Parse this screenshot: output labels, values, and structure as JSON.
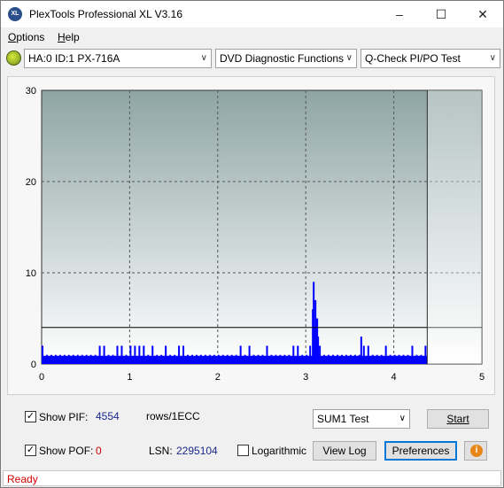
{
  "window": {
    "title": "PlexTools Professional XL V3.16",
    "app_icon_label": "XL",
    "controls": [
      "minimize-icon",
      "maximize-icon",
      "close-icon"
    ]
  },
  "menu": {
    "items": [
      {
        "label": "Options",
        "underline": "O"
      },
      {
        "label": "Help",
        "underline": "H"
      }
    ]
  },
  "toolbar": {
    "drive": "HA:0 ID:1  PX-716A",
    "function": "DVD Diagnostic Functions",
    "test": "Q-Check PI/PO Test"
  },
  "chart_data": {
    "type": "bar",
    "xlim": [
      0,
      5
    ],
    "ylim": [
      0,
      30
    ],
    "x_ticks": [
      "0",
      "1",
      "2",
      "3",
      "4",
      "5"
    ],
    "y_ticks": [
      "0",
      "10",
      "20",
      "30"
    ],
    "grid": true,
    "threshold_line": 4,
    "end_marker_x": 4.38,
    "series_color": "#0000ff",
    "series": [
      {
        "values": [
          [
            0.0,
            2
          ],
          [
            0.05,
            1
          ],
          [
            0.1,
            1
          ],
          [
            0.15,
            1
          ],
          [
            0.2,
            1
          ],
          [
            0.25,
            1
          ],
          [
            0.3,
            1
          ],
          [
            0.35,
            1
          ],
          [
            0.4,
            1
          ],
          [
            0.45,
            1
          ],
          [
            0.5,
            1
          ],
          [
            0.55,
            1
          ],
          [
            0.6,
            1
          ],
          [
            0.65,
            2
          ],
          [
            0.7,
            2
          ],
          [
            0.75,
            1
          ],
          [
            0.8,
            1
          ],
          [
            0.85,
            2
          ],
          [
            0.9,
            2
          ],
          [
            0.95,
            1
          ],
          [
            1.0,
            2
          ],
          [
            1.05,
            2
          ],
          [
            1.1,
            2
          ],
          [
            1.15,
            2
          ],
          [
            1.2,
            1
          ],
          [
            1.25,
            2
          ],
          [
            1.3,
            1
          ],
          [
            1.35,
            1
          ],
          [
            1.4,
            2
          ],
          [
            1.45,
            1
          ],
          [
            1.5,
            1
          ],
          [
            1.55,
            2
          ],
          [
            1.6,
            2
          ],
          [
            1.65,
            1
          ],
          [
            1.7,
            1
          ],
          [
            1.75,
            1
          ],
          [
            1.8,
            1
          ],
          [
            1.85,
            1
          ],
          [
            1.9,
            1
          ],
          [
            1.95,
            1
          ],
          [
            2.0,
            1
          ],
          [
            2.05,
            1
          ],
          [
            2.1,
            1
          ],
          [
            2.15,
            1
          ],
          [
            2.2,
            1
          ],
          [
            2.25,
            2
          ],
          [
            2.3,
            1
          ],
          [
            2.35,
            2
          ],
          [
            2.4,
            1
          ],
          [
            2.45,
            1
          ],
          [
            2.5,
            1
          ],
          [
            2.55,
            2
          ],
          [
            2.6,
            1
          ],
          [
            2.65,
            1
          ],
          [
            2.7,
            1
          ],
          [
            2.75,
            1
          ],
          [
            2.8,
            1
          ],
          [
            2.85,
            2
          ],
          [
            2.9,
            2
          ],
          [
            2.95,
            1
          ],
          [
            3.0,
            1
          ],
          [
            3.04,
            2
          ],
          [
            3.07,
            6
          ],
          [
            3.08,
            9
          ],
          [
            3.09,
            4
          ],
          [
            3.1,
            7
          ],
          [
            3.11,
            5
          ],
          [
            3.12,
            5
          ],
          [
            3.13,
            3
          ],
          [
            3.15,
            2
          ],
          [
            3.2,
            1
          ],
          [
            3.25,
            1
          ],
          [
            3.3,
            1
          ],
          [
            3.35,
            1
          ],
          [
            3.4,
            1
          ],
          [
            3.45,
            1
          ],
          [
            3.5,
            1
          ],
          [
            3.55,
            1
          ],
          [
            3.6,
            1
          ],
          [
            3.62,
            3
          ],
          [
            3.65,
            2
          ],
          [
            3.7,
            2
          ],
          [
            3.75,
            1
          ],
          [
            3.8,
            1
          ],
          [
            3.85,
            1
          ],
          [
            3.9,
            2
          ],
          [
            3.95,
            1
          ],
          [
            4.0,
            1
          ],
          [
            4.05,
            1
          ],
          [
            4.1,
            1
          ],
          [
            4.15,
            1
          ],
          [
            4.2,
            2
          ],
          [
            4.25,
            1
          ],
          [
            4.3,
            1
          ],
          [
            4.35,
            2
          ]
        ]
      }
    ]
  },
  "controls": {
    "show_pif_label": "Show PIF:",
    "show_pif_checked": true,
    "pif_value": "4554",
    "pif_unit": "rows/1ECC",
    "show_pof_label": "Show POF:",
    "show_pof_checked": true,
    "pof_value": "0",
    "lsn_label": "LSN:",
    "lsn_value": "2295104",
    "logarithmic_label": "Logarithmic",
    "logarithmic_checked": false,
    "sum_test_value": "SUM1 Test",
    "start_label": "Start",
    "view_log_label": "View Log",
    "preferences_label": "Preferences",
    "info_icon": "i"
  },
  "status": {
    "text": "Ready",
    "color": "#d00000"
  }
}
